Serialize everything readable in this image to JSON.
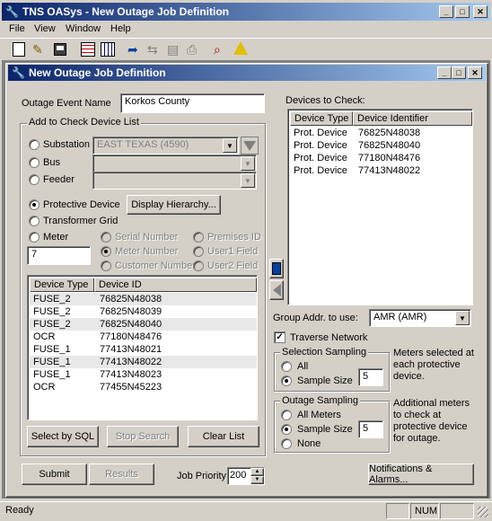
{
  "app": {
    "title": "TNS  OASys  -  New Outage Job Definition",
    "menu": [
      "File",
      "View",
      "Window",
      "Help"
    ]
  },
  "toolbar": {
    "icons": [
      "new-icon",
      "open-icon",
      "save-icon",
      "grid-icon",
      "grid2-icon",
      "export-icon",
      "import-icon",
      "preview-icon",
      "print-icon",
      "find-icon",
      "alert-icon"
    ]
  },
  "child": {
    "title": "New Outage Job Definition"
  },
  "form": {
    "event_name_label": "Outage Event Name",
    "event_name_value": "Korkos County",
    "check_list_group": "Add to Check Device List",
    "substation_label": "Substation",
    "substation_value": "EAST TEXAS (4590)",
    "bus_label": "Bus",
    "feeder_label": "Feeder",
    "protective_label": "Protective Device",
    "display_hierarchy": "Display Hierarchy...",
    "transformer_label": "Transformer Grid",
    "meter_label": "Meter",
    "serial_number": "Serial Number",
    "meter_number": "Meter Number",
    "customer_number": "Customer Number",
    "premises_id": "Premises ID",
    "user1_field": "User1 Field",
    "user2_field": "User2 Field",
    "meter_value": "7",
    "select_sql": "Select by SQL",
    "stop_search": "Stop Search",
    "clear_list": "Clear List",
    "submit": "Submit",
    "results": "Results",
    "job_priority_label": "Job Priority",
    "job_priority_value": "200"
  },
  "device_list": {
    "headers": [
      "Device Type",
      "Device ID"
    ],
    "rows": [
      {
        "type": "FUSE_2",
        "id": "76825N48038",
        "selected": true
      },
      {
        "type": "FUSE_2",
        "id": "76825N48039",
        "selected": false
      },
      {
        "type": "FUSE_2",
        "id": "76825N48040",
        "selected": true
      },
      {
        "type": "OCR",
        "id": "77180N48476",
        "selected": false
      },
      {
        "type": "FUSE_1",
        "id": "77413N48021",
        "selected": false
      },
      {
        "type": "FUSE_1",
        "id": "77413N48022",
        "selected": true
      },
      {
        "type": "FUSE_1",
        "id": "77413N48023",
        "selected": false
      },
      {
        "type": "OCR",
        "id": "77455N45223",
        "selected": false
      }
    ]
  },
  "devices_to_check": {
    "label": "Devices to Check:",
    "headers": [
      "Device Type",
      "Device Identifier"
    ],
    "rows": [
      {
        "type": "Prot. Device",
        "id": "76825N48038"
      },
      {
        "type": "Prot. Device",
        "id": "76825N48040"
      },
      {
        "type": "Prot. Device",
        "id": "77180N48476"
      },
      {
        "type": "Prot. Device",
        "id": "77413N48022"
      }
    ]
  },
  "right": {
    "group_addr_label": "Group Addr. to use:",
    "group_addr_value": "AMR  (AMR)",
    "traverse_label": "Traverse Network",
    "selection_group": "Selection Sampling",
    "sel_all": "All",
    "sel_sample_size": "Sample Size",
    "sel_sample_value": "5",
    "sel_note": "Meters selected at each protective device.",
    "outage_group": "Outage Sampling",
    "out_all": "All Meters",
    "out_sample_size": "Sample Size",
    "out_sample_value": "5",
    "out_none": "None",
    "out_note": "Additional meters to check at protective device for outage.",
    "notifications": "Notifications & Alarms..."
  },
  "statusbar": {
    "text": "Ready",
    "num": "NUM"
  }
}
